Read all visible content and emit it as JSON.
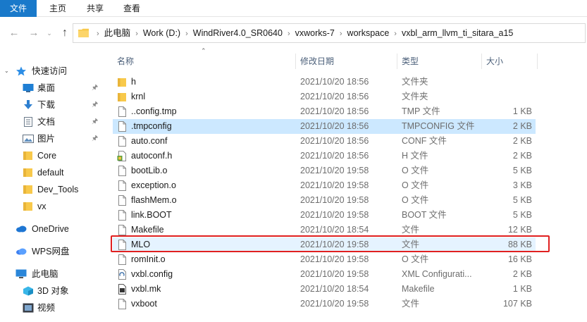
{
  "ribbon": {
    "tabs": [
      "文件",
      "主页",
      "共享",
      "查看"
    ]
  },
  "address": {
    "breadcrumbs": [
      "此电脑",
      "Work (D:)",
      "WindRiver4.0_SR0640",
      "vxworks-7",
      "workspace",
      "vxbl_arm_llvm_ti_sitara_a15"
    ]
  },
  "sidebar": {
    "items": [
      {
        "label": "快速访问",
        "icon": "star-icon"
      },
      {
        "label": "桌面",
        "icon": "desktop-icon",
        "pinned": true
      },
      {
        "label": "下载",
        "icon": "download-icon",
        "pinned": true
      },
      {
        "label": "文档",
        "icon": "document-icon",
        "pinned": true
      },
      {
        "label": "图片",
        "icon": "picture-icon",
        "pinned": true
      },
      {
        "label": "Core",
        "icon": "folder-icon"
      },
      {
        "label": "default",
        "icon": "folder-icon"
      },
      {
        "label": "Dev_Tools",
        "icon": "folder-icon"
      },
      {
        "label": "vx",
        "icon": "folder-icon"
      },
      {
        "label": "OneDrive",
        "icon": "cloud-icon"
      },
      {
        "label": "WPS网盘",
        "icon": "wps-cloud-icon"
      },
      {
        "label": "此电脑",
        "icon": "computer-icon"
      },
      {
        "label": "3D 对象",
        "icon": "3d-objects-icon"
      },
      {
        "label": "视频",
        "icon": "video-icon"
      }
    ]
  },
  "columns": {
    "name": "名称",
    "date": "修改日期",
    "type": "类型",
    "size": "大小"
  },
  "files": [
    {
      "name": "h",
      "date": "2021/10/20 18:56",
      "type": "文件夹",
      "size": "",
      "icon": "folder-icon"
    },
    {
      "name": "krnl",
      "date": "2021/10/20 18:56",
      "type": "文件夹",
      "size": "",
      "icon": "folder-icon"
    },
    {
      "name": "..config.tmp",
      "date": "2021/10/20 18:56",
      "type": "TMP 文件",
      "size": "1 KB",
      "icon": "file-icon"
    },
    {
      "name": ".tmpconfig",
      "date": "2021/10/20 18:56",
      "type": "TMPCONFIG 文件",
      "size": "2 KB",
      "icon": "file-icon"
    },
    {
      "name": "auto.conf",
      "date": "2021/10/20 18:56",
      "type": "CONF 文件",
      "size": "2 KB",
      "icon": "file-icon"
    },
    {
      "name": "autoconf.h",
      "date": "2021/10/20 18:56",
      "type": "H 文件",
      "size": "2 KB",
      "icon": "header-file-icon"
    },
    {
      "name": "bootLib.o",
      "date": "2021/10/20 19:58",
      "type": "O 文件",
      "size": "5 KB",
      "icon": "file-icon"
    },
    {
      "name": "exception.o",
      "date": "2021/10/20 19:58",
      "type": "O 文件",
      "size": "3 KB",
      "icon": "file-icon"
    },
    {
      "name": "flashMem.o",
      "date": "2021/10/20 19:58",
      "type": "O 文件",
      "size": "5 KB",
      "icon": "file-icon"
    },
    {
      "name": "link.BOOT",
      "date": "2021/10/20 19:58",
      "type": "BOOT 文件",
      "size": "5 KB",
      "icon": "file-icon"
    },
    {
      "name": "Makefile",
      "date": "2021/10/20 18:54",
      "type": "文件",
      "size": "12 KB",
      "icon": "file-icon"
    },
    {
      "name": "MLO",
      "date": "2021/10/20 19:58",
      "type": "文件",
      "size": "88 KB",
      "icon": "file-icon"
    },
    {
      "name": "romInit.o",
      "date": "2021/10/20 19:58",
      "type": "O 文件",
      "size": "16 KB",
      "icon": "file-icon"
    },
    {
      "name": "vxbl.config",
      "date": "2021/10/20 19:58",
      "type": "XML Configurati...",
      "size": "2 KB",
      "icon": "xml-file-icon"
    },
    {
      "name": "vxbl.mk",
      "date": "2021/10/20 18:54",
      "type": "Makefile",
      "size": "1 KB",
      "icon": "makefile-icon"
    },
    {
      "name": "vxboot",
      "date": "2021/10/20 19:58",
      "type": "文件",
      "size": "107 KB",
      "icon": "file-icon"
    }
  ],
  "colors": {
    "accent": "#1979ca",
    "selection": "#cce8ff",
    "hover": "#e5f3ff",
    "highlight_box": "#e02020",
    "folder": "#f8c94b"
  }
}
